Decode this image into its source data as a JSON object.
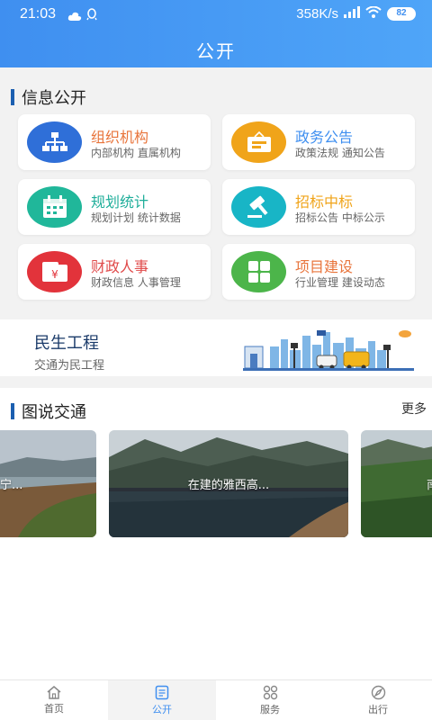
{
  "status_bar": {
    "time": "21:03",
    "speed": "358K/s",
    "battery": "82"
  },
  "header": {
    "title": "公开"
  },
  "info_section": {
    "title": "信息公开",
    "cards": [
      {
        "title": "组织机构",
        "subtitle": "内部机构 直属机构",
        "icon": "org-chart-icon",
        "title_color": "#e8743b",
        "icon_color": "#2f6fd8"
      },
      {
        "title": "政务公告",
        "subtitle": "政策法规 通知公告",
        "icon": "notice-board-icon",
        "title_color": "#3f8ff0",
        "icon_color": "#f0a41a"
      },
      {
        "title": "规划统计",
        "subtitle": "规划计划 统计数据",
        "icon": "calendar-icon",
        "title_color": "#1fae9a",
        "icon_color": "#20b79a"
      },
      {
        "title": "招标中标",
        "subtitle": "招标公告 中标公示",
        "icon": "gavel-icon",
        "title_color": "#f0a41a",
        "icon_color": "#18b5c6"
      },
      {
        "title": "财政人事",
        "subtitle": "财政信息 人事管理",
        "icon": "finance-icon",
        "title_color": "#e04a4a",
        "icon_color": "#e2333b"
      },
      {
        "title": "项目建设",
        "subtitle": "行业管理 建设动态",
        "icon": "grid-icon",
        "title_color": "#e8743b",
        "icon_color": "#4cb54a"
      }
    ]
  },
  "banner": {
    "title": "民生工程",
    "subtitle": "交通为民工程"
  },
  "pictures_section": {
    "title": "图说交通",
    "more": "更多",
    "photos": [
      {
        "caption": "宁..."
      },
      {
        "caption": "在建的雅西高..."
      },
      {
        "caption": "南"
      }
    ]
  },
  "tabbar": {
    "tabs": [
      {
        "label": "首页",
        "icon": "home-icon"
      },
      {
        "label": "公开",
        "icon": "document-icon",
        "active": true
      },
      {
        "label": "服务",
        "icon": "services-grid-icon"
      },
      {
        "label": "出行",
        "icon": "navigation-icon"
      }
    ]
  }
}
